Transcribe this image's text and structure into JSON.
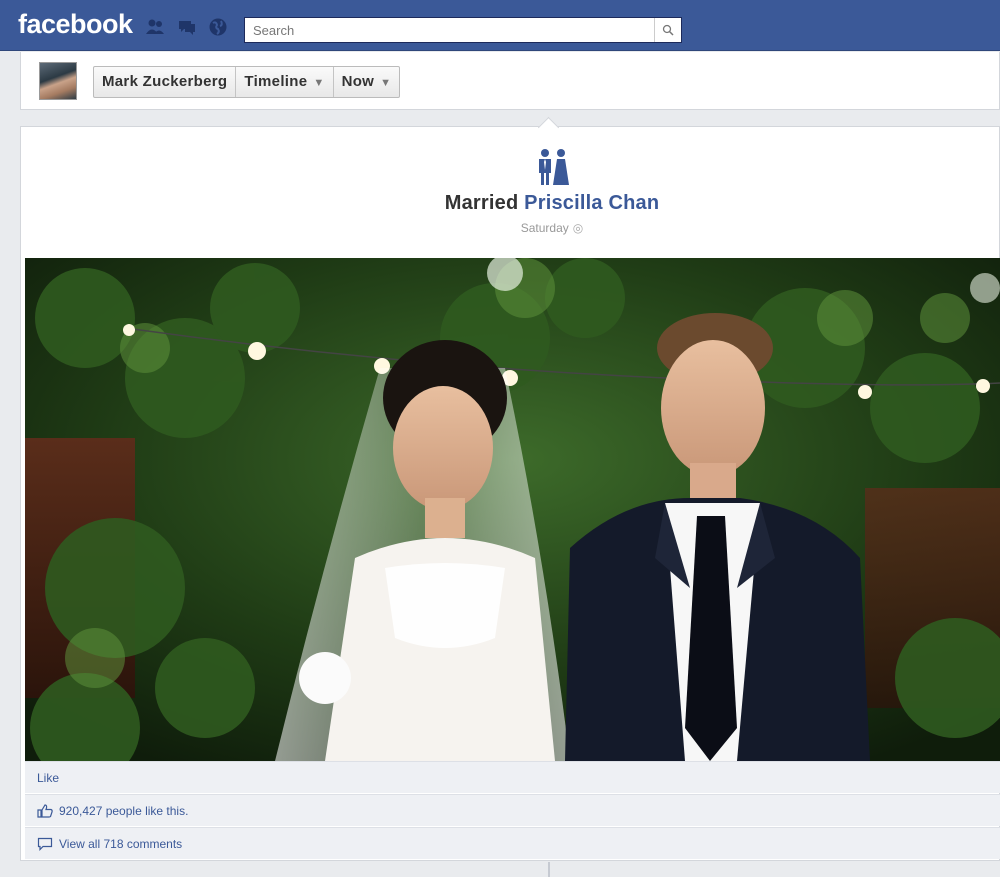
{
  "header": {
    "logo": "facebook",
    "search_placeholder": "Search"
  },
  "profile_nav": {
    "name": "Mark Zuckerberg",
    "timeline": "Timeline",
    "period": "Now"
  },
  "event": {
    "verb": "Married",
    "partner": "Priscilla Chan",
    "date": "Saturday"
  },
  "post_footer": {
    "like": "Like",
    "likes": "920,427 people like this.",
    "comments": "View all 718 comments"
  },
  "colors": {
    "brand_blue": "#3b5998",
    "background": "#e9ebee"
  },
  "icons": [
    "friends-icon",
    "messages-icon",
    "globe-icon",
    "search-icon",
    "wedding-icon",
    "thumbs-up-icon",
    "comment-icon"
  ]
}
